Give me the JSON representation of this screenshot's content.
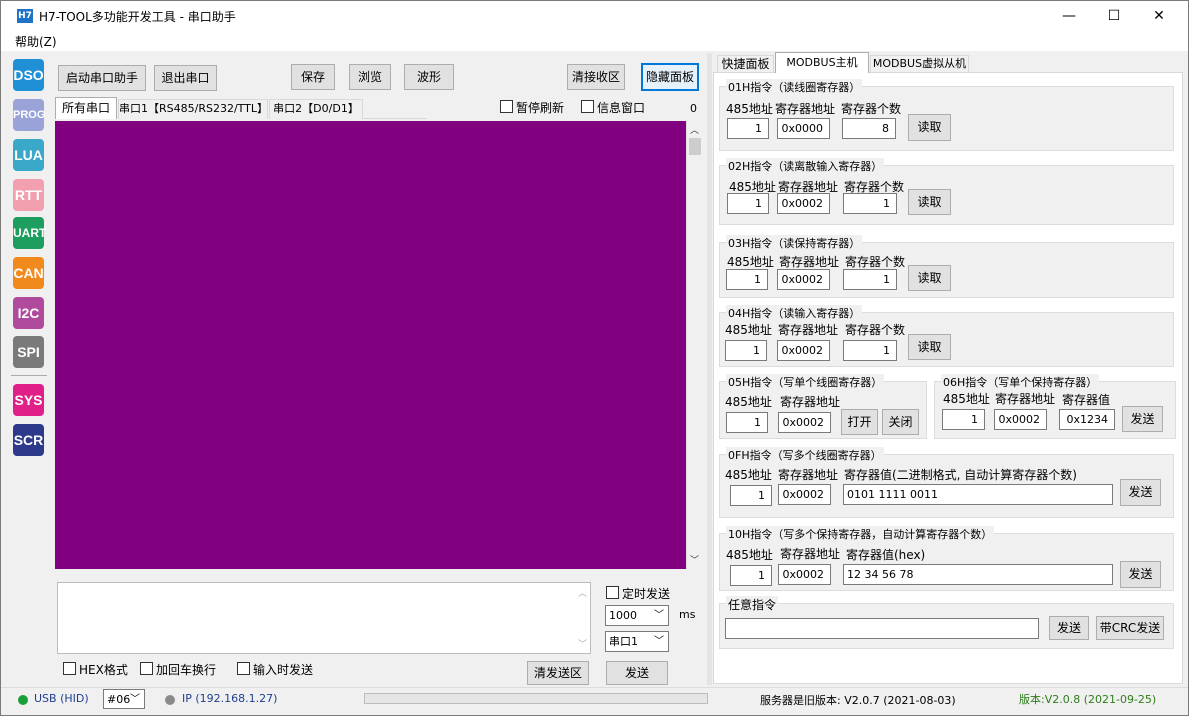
{
  "window": {
    "icon_text": "H7",
    "title": "H7-TOOL多功能开发工具 - 串口助手",
    "minimize": "—",
    "maximize": "☐",
    "close": "✕"
  },
  "menu": {
    "help": "帮助(Z)"
  },
  "sidebar": {
    "items": [
      {
        "label": "DSO",
        "color": "#1f8fd6"
      },
      {
        "label": "PROG",
        "color": "#9aa3d8"
      },
      {
        "label": "LUA",
        "color": "#3aa8c9"
      },
      {
        "label": "RTT",
        "color": "#f2a0b0"
      },
      {
        "label": "UART",
        "color": "#1e9e5e"
      },
      {
        "label": "CAN",
        "color": "#f08a1c"
      },
      {
        "label": "I2C",
        "color": "#b04a9c"
      },
      {
        "label": "SPI",
        "color": "#7a7a7a"
      },
      {
        "label": "SYS",
        "color": "#e02088"
      },
      {
        "label": "SCR",
        "color": "#2d3a8c"
      }
    ]
  },
  "toolbar": {
    "start": "启动串口助手",
    "exit": "退出串口",
    "save": "保存",
    "browse": "浏览",
    "wave": "波形",
    "clear_recv": "清接收区",
    "hide_panel": "隐藏面板"
  },
  "port_tabs": {
    "all": "所有串口",
    "port1": "串口1【RS485/RS232/TTL】",
    "port2": "串口2【D0/D1】",
    "pause_refresh": "暂停刷新",
    "info_window": "信息窗口",
    "count": "0"
  },
  "recv_area": {
    "bg_color": "#800080"
  },
  "send": {
    "timed_send": "定时发送",
    "interval": "1000",
    "unit": "ms",
    "port": "串口1",
    "hex": "HEX格式",
    "add_crlf": "加回车换行",
    "send_on_input": "输入时发送",
    "clear_send": "清发送区",
    "send": "发送"
  },
  "right_tabs": {
    "quick": "快捷面板",
    "master": "MODBUS主机",
    "slave": "MODBUS虚拟从机"
  },
  "modbus": {
    "lbl_addr": "485地址",
    "lbl_reg": "寄存器地址",
    "lbl_count": "寄存器个数",
    "lbl_val": "寄存器值",
    "read": "读取",
    "send": "发送",
    "open": "打开",
    "close": "关闭",
    "g01": {
      "title": "01H指令（读线圈寄存器）",
      "addr": "1",
      "reg": "0x0000",
      "count": "8"
    },
    "g02": {
      "title": "02H指令（读离散输入寄存器）",
      "addr": "1",
      "reg": "0x0002",
      "count": "1"
    },
    "g03": {
      "title": "03H指令（读保持寄存器）",
      "addr": "1",
      "reg": "0x0002",
      "count": "1"
    },
    "g04": {
      "title": "04H指令（读输入寄存器）",
      "addr": "1",
      "reg": "0x0002",
      "count": "1"
    },
    "g05": {
      "title": "05H指令（写单个线圈寄存器）",
      "addr": "1",
      "reg": "0x0002"
    },
    "g06": {
      "title": "06H指令（写单个保持寄存器）",
      "addr": "1",
      "reg": "0x0002",
      "val": "0x1234"
    },
    "g0f": {
      "title": "0FH指令（写多个线圈寄存器）",
      "val_label": "寄存器值(二进制格式, 自动计算寄存器个数)",
      "addr": "1",
      "reg": "0x0002",
      "val": "0101 1111 0011"
    },
    "g10": {
      "title": "10H指令（写多个保持寄存器，自动计算寄存器个数）",
      "val_label": "寄存器值(hex)",
      "addr": "1",
      "reg": "0x0002",
      "val": "12 34 56 78"
    },
    "any": {
      "title": "任意指令",
      "send": "发送",
      "send_crc": "带CRC发送"
    }
  },
  "status": {
    "usb": "USB (HID)",
    "dev": "#06",
    "ip": "IP (192.168.1.27)",
    "server_version": "服务器是旧版本: V2.0.7 (2021-08-03)",
    "version": "版本:V2.0.8 (2021-09-25)"
  }
}
